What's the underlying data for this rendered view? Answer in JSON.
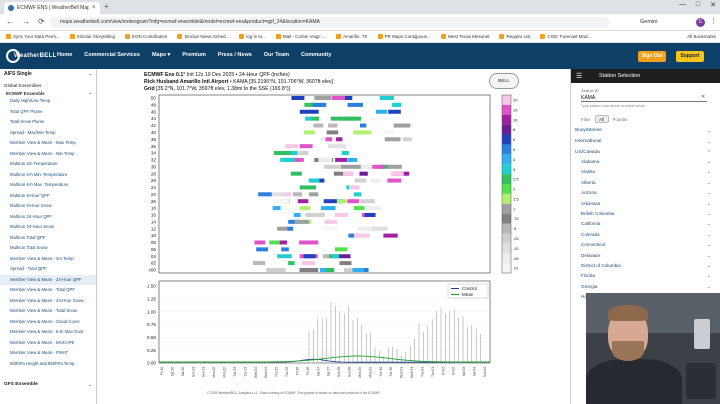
{
  "browser": {
    "tab_title": "ECMWF ENS | WeatherBell Maps",
    "tab_close": "×",
    "new_tab": "+",
    "window_controls": [
      "—",
      "□",
      "✕"
    ],
    "nav": [
      "←",
      "→",
      "⟳"
    ],
    "url": "maps.weatherbell.com/view/meteogram?mfg=ecmwf-ensemble&model=ecmwf-ens&product=qpf_24&location=KAMA",
    "gemini": "Gemini",
    "profile_initial": "C",
    "menu": "⋮",
    "bookmarks": [
      "Sync Your Data Perm...",
      "Sinclair Storytelling",
      "EON Contribution",
      "Sinclair News Sched...",
      "log in to...",
      "Mail - Corbin Voigt -...",
      "Amarillo, TX",
      "PR Maps Contiguous...",
      "West Texas Mesonet",
      "Regular List",
      "COD: Forecast Mod..."
    ],
    "all_bookmarks": "All Bookmarks"
  },
  "site": {
    "logo_text": "WeatherBELL",
    "nav": [
      "Home",
      "Commercial Services",
      "Maps ▾",
      "Premium",
      "Press / News",
      "Our Team",
      "Community"
    ],
    "sign_out": "Sign Out",
    "support": "Support"
  },
  "sidebar": {
    "section1": "AIFS Single",
    "section2": "Global Ensembles",
    "subsection": "ECMWF Ensemble",
    "chevron": "⌄",
    "items": [
      "Daily High/Low Temp",
      "Total QPF Plume",
      "Total Snow Plume",
      "Spread - Max/Min Temp",
      "Member View & Mean - Max Temp",
      "Member View & Mean - Min Temp",
      "Multirun 2m Temperature",
      "Multirun 6-h Min. Temperature",
      "Multirun 6-h Max. Temperature",
      "Multirun 6-Hour QPF",
      "Multirun 6-Hour Snow",
      "Multirun 24-Hour QPF",
      "Multirun 24-Hour Snow",
      "Multirun Total QPF",
      "Multirun Total Snow",
      "Member View & Mean - 2m Temp",
      "Spread - Total QPF",
      "Member View & Mean - 24-Hour QPF",
      "Member View & Mean - Total QPF",
      "Member View & Mean - 24-Hour Snow",
      "Member View & Mean - Total Snow",
      "Member View & Mean - Cloud Cover",
      "Member View & Mean - 6-hr Max Gust",
      "Member View & Mean - MUCAPE",
      "Member View & Mean - PWAT",
      "500hPa Height and 850hPa Temp"
    ],
    "active_index": 17,
    "footer": "GFS Ensemble"
  },
  "main": {
    "title_line1": "ECMWF Ens 0.1°",
    "title_line1_rest": "Init 12z 19 Dec 2025 • 24-Hour QPF (inches)",
    "title_line2": "Rick Husband Amarillo Intl Airport",
    "title_line2_rest": "• KAMA [35.2196°N, 101.706°W, 3607ft elev]",
    "title_line3": "Grid",
    "title_line3_rest": "[35.2°N, 101.7°W, 3597ft elev, 1.38mi to the SSE (165.8°)]",
    "badge": "BELL",
    "footer_note": "© 2025 WeatherBELL Analytics LLC. Data courtesy of ECMWF. This graphic is based on data and products of the ECMWF."
  },
  "chart_data": [
    {
      "type": "heatmap",
      "title": "ECMWF Ens 0.1° Init 12z 19 Dec 2025 • 24-Hour QPF (inches)",
      "y_ticks": [
        "50",
        "48",
        "46",
        "44",
        "42",
        "40",
        "38",
        "36",
        "34",
        "32",
        "30",
        "28",
        "26",
        "24",
        "22",
        "20",
        "18",
        "16",
        "14",
        "12",
        "10",
        "08",
        "06",
        "04",
        "02",
        "c00"
      ],
      "colorbar_ticks": [
        "20",
        "15",
        "10",
        "8",
        "6",
        "5",
        "4",
        "3",
        "2.5",
        "2",
        "1.5",
        "1",
        ".75",
        ".5",
        ".25",
        ".10",
        ".05",
        ".01"
      ]
    },
    {
      "type": "line",
      "y_ticks": [
        "1.50",
        "1.25",
        "1.00",
        "0.75",
        "0.50",
        "0.25",
        "0.00"
      ],
      "ylim": [
        0,
        1.6
      ],
      "x_labels": [
        "Fri 19",
        "Sat 20",
        "Sat 20",
        "Sun 21",
        "Sun 21",
        "Mon 22",
        "Mon 22",
        "Tue 23",
        "Tue 23",
        "Wed 24",
        "Wed 24",
        "Thu 25",
        "Thu 25",
        "Fri 26",
        "Fri 26",
        "Sat 27",
        "Sat 27",
        "Sun 28",
        "Sun 28",
        "Mon 29",
        "Mon 29",
        "Tue 30",
        "Tue 30",
        "Wed 31",
        "Wed 31",
        "Thu 01",
        "Thu 01",
        "Fri 02",
        "Fri 02",
        "Sat 03",
        "Sat 03",
        "Sun 04"
      ],
      "series": [
        {
          "name": "Control",
          "color": "#1f3d8a"
        },
        {
          "name": "Mean",
          "color": "#20a030"
        }
      ]
    }
  ],
  "station_panel": {
    "menu_icon": "☰",
    "title": "Station Selection",
    "search_label": "Search ID",
    "search_value": "KAMA",
    "clear": "✕",
    "hint": "Type station code above or select below",
    "filter_label": "Filter",
    "filter_all": "All",
    "filter_popular": "Popular",
    "categories": [
      "Buoy/Marine",
      "International",
      "US/Canada"
    ],
    "states": [
      "Alabama",
      "Alaska",
      "Alberta",
      "Arizona",
      "Arkansas",
      "British Columbia",
      "California",
      "Colorado",
      "Connecticut",
      "Delaware",
      "District of Columbia",
      "Florida",
      "Georgia",
      "Hawaii"
    ]
  }
}
